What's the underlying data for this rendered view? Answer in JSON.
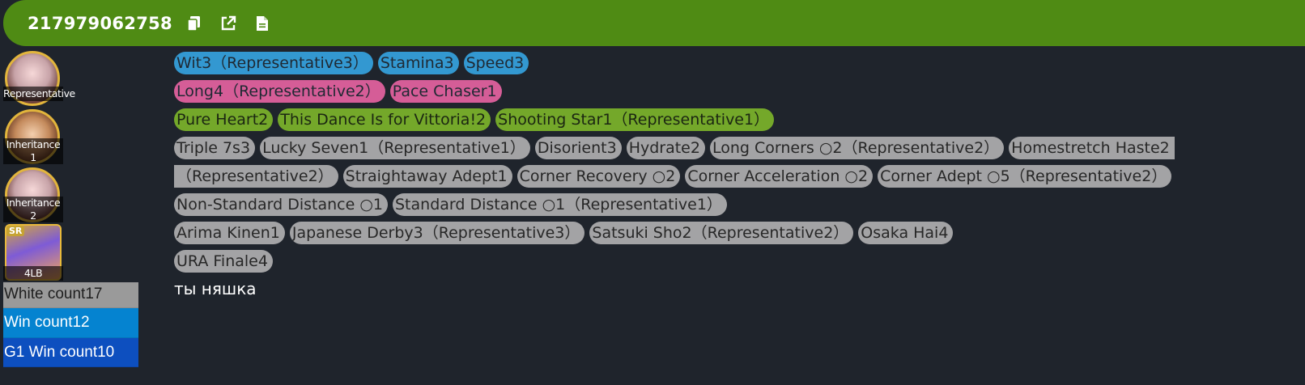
{
  "header": {
    "id": "217979062758",
    "icons": [
      "copy-icon",
      "open-external-icon",
      "document-icon"
    ],
    "color": "#4f8b14"
  },
  "cards": [
    {
      "label": "Representative"
    },
    {
      "label": "Inheritance",
      "sub": "1"
    },
    {
      "label": "Inheritance",
      "sub": "2"
    },
    {
      "label": "4LB",
      "badge": "SR"
    }
  ],
  "stats": {
    "white": "White count17",
    "win": "Win count12",
    "g1": "G1 Win count10"
  },
  "tags": {
    "row1": [
      "Wit3（Representative3）",
      "Stamina3",
      "Speed3"
    ],
    "row2": [
      "Long4（Representative2）",
      "Pace Chaser1"
    ],
    "row3": [
      "Pure Heart2",
      "This Dance Is for Vittoria!2",
      "Shooting Star1（Representative1）"
    ],
    "row4": [
      "Triple 7s3",
      "Lucky Seven1（Representative1）",
      "Disorient3",
      "Hydrate2",
      "Long Corners ○2（Representative2）",
      "Homestretch Haste2"
    ],
    "row5": [
      "（Representative2）",
      "Straightaway Adept1",
      "Corner Recovery ○2",
      "Corner Acceleration ○2",
      "Corner Adept ○5（Representative2）"
    ],
    "row6": [
      "Non-Standard Distance ○1",
      "Standard Distance ○1（Representative1）"
    ],
    "row7": [
      "Arima Kinen1",
      "Japanese Derby3（Representative3）",
      "Satsuki Sho2（Representative2）",
      "Osaka Hai4"
    ],
    "row8": [
      "URA Finale4"
    ]
  },
  "note": "ты няшка",
  "colors": {
    "blue_tag": "#3398d1",
    "pink_tag": "#d55d97",
    "green_tag": "#74a82a",
    "gray_tag": "#a3a3a5",
    "background": "#1f242c"
  }
}
